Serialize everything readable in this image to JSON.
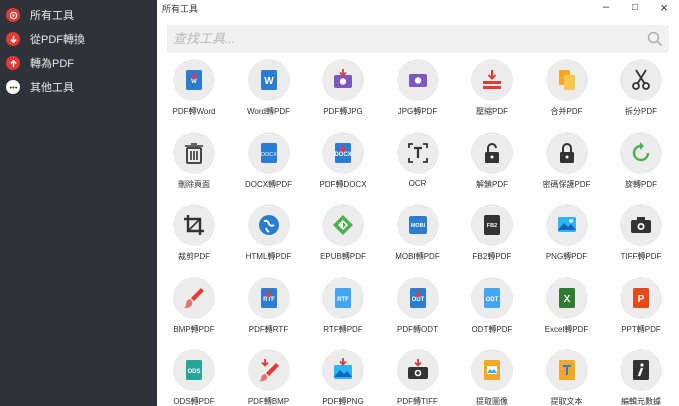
{
  "sidebar": {
    "items": [
      {
        "label": "所有工具",
        "icon": "target-icon"
      },
      {
        "label": "從PDF轉換",
        "icon": "arrow-down-icon"
      },
      {
        "label": "轉為PDF",
        "icon": "arrow-up-icon"
      },
      {
        "label": "其他工具",
        "icon": "more-icon"
      }
    ]
  },
  "titlebar": {
    "title": "所有工具",
    "minimize": "–",
    "maximize": "□",
    "close": "×"
  },
  "search": {
    "placeholder": "查找工具...",
    "value": ""
  },
  "tools": [
    {
      "label": "PDF轉Word",
      "icon": "pdf-to-word-icon"
    },
    {
      "label": "Word轉PDF",
      "icon": "word-to-pdf-icon"
    },
    {
      "label": "PDF轉JPG",
      "icon": "pdf-to-jpg-icon"
    },
    {
      "label": "JPG轉PDF",
      "icon": "jpg-to-pdf-icon"
    },
    {
      "label": "壓縮PDF",
      "icon": "compress-pdf-icon"
    },
    {
      "label": "合并PDF",
      "icon": "merge-pdf-icon"
    },
    {
      "label": "拆分PDF",
      "icon": "split-pdf-icon"
    },
    {
      "label": "刪除頁面",
      "icon": "delete-pages-icon"
    },
    {
      "label": "DOCX轉PDF",
      "icon": "docx-to-pdf-icon"
    },
    {
      "label": "PDF轉DOCX",
      "icon": "pdf-to-docx-icon"
    },
    {
      "label": "OCR",
      "icon": "ocr-icon"
    },
    {
      "label": "解鎖PDF",
      "icon": "unlock-pdf-icon"
    },
    {
      "label": "密碼保護PDF",
      "icon": "protect-pdf-icon"
    },
    {
      "label": "旋轉PDF",
      "icon": "rotate-pdf-icon"
    },
    {
      "label": "裁剪PDF",
      "icon": "crop-pdf-icon"
    },
    {
      "label": "HTML轉PDF",
      "icon": "html-to-pdf-icon"
    },
    {
      "label": "EPUB轉PDF",
      "icon": "epub-to-pdf-icon"
    },
    {
      "label": "MOBI轉PDF",
      "icon": "mobi-to-pdf-icon"
    },
    {
      "label": "FB2轉PDF",
      "icon": "fb2-to-pdf-icon"
    },
    {
      "label": "PNG轉PDF",
      "icon": "png-to-pdf-icon"
    },
    {
      "label": "TIFF轉PDF",
      "icon": "tiff-to-pdf-icon"
    },
    {
      "label": "BMP轉PDF",
      "icon": "bmp-to-pdf-icon"
    },
    {
      "label": "PDF轉RTF",
      "icon": "pdf-to-rtf-icon"
    },
    {
      "label": "RTF轉PDF",
      "icon": "rtf-to-pdf-icon"
    },
    {
      "label": "PDF轉ODT",
      "icon": "pdf-to-odt-icon"
    },
    {
      "label": "ODT轉PDF",
      "icon": "odt-to-pdf-icon"
    },
    {
      "label": "Excel轉PDF",
      "icon": "excel-to-pdf-icon"
    },
    {
      "label": "PPT轉PDF",
      "icon": "ppt-to-pdf-icon"
    },
    {
      "label": "ODS轉PDF",
      "icon": "ods-to-pdf-icon"
    },
    {
      "label": "PDF轉BMP",
      "icon": "pdf-to-bmp-icon"
    },
    {
      "label": "PDF轉PNG",
      "icon": "pdf-to-png-icon"
    },
    {
      "label": "PDF轉TIFF",
      "icon": "pdf-to-tiff-icon"
    },
    {
      "label": "提取圖像",
      "icon": "extract-images-icon"
    },
    {
      "label": "提取文本",
      "icon": "extract-text-icon"
    },
    {
      "label": "編輯元數據",
      "icon": "edit-metadata-icon"
    }
  ],
  "colors": {
    "sidebar_bg": "#2f3339",
    "accent_red": "#e53935",
    "word_blue": "#2b7cd3",
    "pdf_red": "#e53935",
    "purple": "#7e57c2",
    "orange": "#f5a623",
    "green": "#4caf50",
    "teal": "#26a69a",
    "dark": "#333333"
  }
}
